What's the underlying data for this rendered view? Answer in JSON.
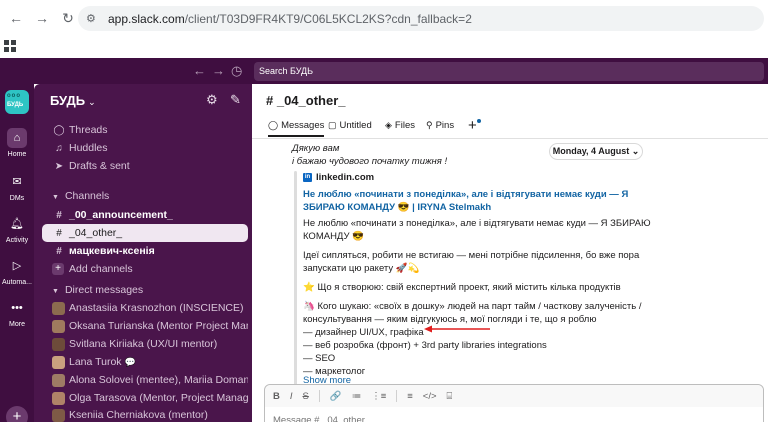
{
  "browser": {
    "url_host": "app.slack.com",
    "url_path": "/client/T03D9FR4KT9/C06L5KCL2KS?cdn_fallback=2"
  },
  "topbar": {
    "search_placeholder": "Search БУДЬ"
  },
  "rail": {
    "workspace_logo_top": "ooo",
    "workspace_logo_name": "БУДЬ",
    "items": [
      {
        "label": "Home",
        "icon": "home-icon"
      },
      {
        "label": "DMs",
        "icon": "dms-icon"
      },
      {
        "label": "Activity",
        "icon": "bell-icon"
      },
      {
        "label": "Automa...",
        "icon": "automations-icon"
      },
      {
        "label": "More",
        "icon": "more-icon"
      }
    ]
  },
  "sidebar": {
    "workspace_name": "БУДЬ",
    "nav": [
      {
        "label": "Threads",
        "icon": "threads-icon"
      },
      {
        "label": "Huddles",
        "icon": "headphones-icon"
      },
      {
        "label": "Drafts & sent",
        "icon": "send-icon"
      }
    ],
    "channels_header": "Channels",
    "channels": [
      {
        "label": "_00_announcement_",
        "bold": true,
        "selected": false
      },
      {
        "label": "_04_other_",
        "bold": false,
        "selected": true
      },
      {
        "label": "мацкевич-ксенія",
        "bold": true,
        "selected": false
      }
    ],
    "add_channels": "Add channels",
    "dm_header": "Direct messages",
    "dms": [
      {
        "label": "Anastasiia Krasnozhon (INSCIENCE)",
        "avatar_color": "#8c6b4f"
      },
      {
        "label": "Oksana Turianska (Mentor Project Mana...",
        "avatar_color": "#a07a5e"
      },
      {
        "label": "Svitlana Kiriiaka (UX/UI mentor)",
        "avatar_color": "#6d4b3a"
      },
      {
        "label": "Lana Turok",
        "avatar_color": "#c9a07f",
        "extra": "💬"
      },
      {
        "label": "Alona Solovei (mentee), Mariia Domansk...",
        "avatar_color": "#9e7b65"
      },
      {
        "label": "Olga Tarasova (Mentor, Project Manage...",
        "avatar_color": "#b08368"
      },
      {
        "label": "Kseniia Cherniakova (mentor)",
        "avatar_color": "#7e5a46"
      }
    ]
  },
  "channel": {
    "title": "# _04_other_",
    "tabs": [
      {
        "label": "Messages",
        "icon": "messages-icon"
      },
      {
        "label": "Untitled",
        "icon": "canvas-icon"
      },
      {
        "label": "Files",
        "icon": "files-icon"
      },
      {
        "label": "Pins",
        "icon": "pin-icon"
      }
    ]
  },
  "message": {
    "line1": "Дякую вам",
    "line2": "і бажаю чудового початку тижня !",
    "date": "Monday, 4 August",
    "source": "linkedin.com",
    "link_title": "Не люблю «починати з понеділка», але і відтягувати немає куди — Я ЗБИРАЮ КОМАНДУ 😎 | IRYNA Stelmakh",
    "body": [
      "Не люблю «починати з понеділка», але і відтягувати немає куди — Я ЗБИРАЮ",
      "КОМАНДУ 😎",
      "Ідеї сипляться, робити не встигаю — мені потрібне підсилення, бо вже пора",
      "запускати цю ракету 🚀💫",
      "⭐ Що я створюю: свій експертний проект, який містить кілька продуктів",
      "🦄 Кого шукаю: «своїх в дошку» людей на парт тайм / часткову залученість /",
      "консультування — яким відгукуюсь я, мої погляди і те, що я роблю",
      "— дизайнер UI/UX, графіка",
      "— веб розробка (фронт) + 3rd party libraries integrations",
      "— SEO",
      "— маркетолог"
    ],
    "show_more": "Show more"
  },
  "composer": {
    "placeholder": "Message # _04_other_",
    "tools": [
      "B",
      "I",
      "S",
      "🔗",
      "≔",
      "⋮≡",
      "≡",
      "</>",
      "⌸"
    ]
  },
  "colors": {
    "aubergine": "#3f0e40",
    "sidebar": "#4a154b",
    "link": "#1264a3",
    "arrow": "#e01e1e"
  }
}
